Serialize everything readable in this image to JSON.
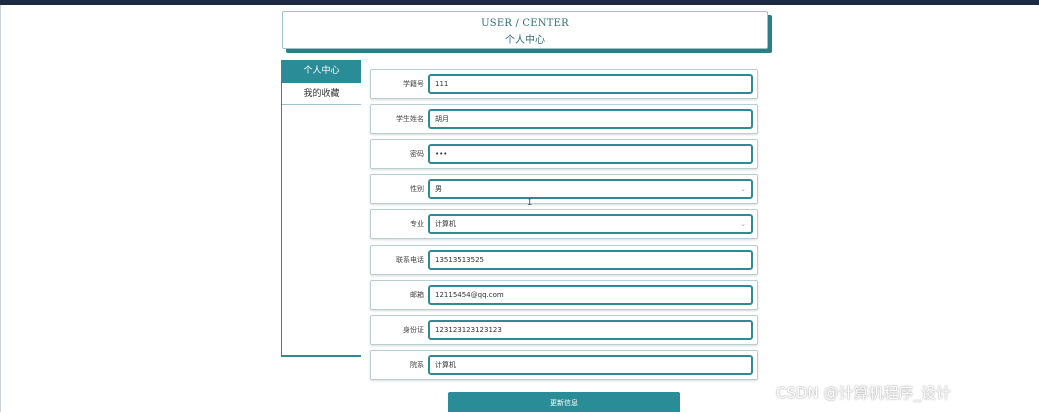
{
  "header": {
    "title_en": "USER / CENTER",
    "title_cn": "个人中心"
  },
  "sidebar": {
    "items": [
      {
        "label": "个人中心",
        "active": true
      },
      {
        "label": "我的收藏",
        "active": false
      }
    ]
  },
  "form": {
    "fields": [
      {
        "label": "学籍号",
        "value": "111",
        "type": "text"
      },
      {
        "label": "学生姓名",
        "value": "胡月",
        "type": "text"
      },
      {
        "label": "密码",
        "value": "•••",
        "type": "password"
      },
      {
        "label": "性别",
        "value": "男",
        "type": "select"
      },
      {
        "label": "专业",
        "value": "计算机",
        "type": "select"
      },
      {
        "label": "联系电话",
        "value": "13513513525",
        "type": "text"
      },
      {
        "label": "邮箱",
        "value": "12115454@qq.com",
        "type": "text"
      },
      {
        "label": "身份证",
        "value": "123123123123123",
        "type": "text"
      },
      {
        "label": "院系",
        "value": "计算机",
        "type": "text"
      }
    ],
    "submit_label": "更新信息"
  },
  "cursor_glyph": "I",
  "watermark": "CSDN @计算机程序_设计",
  "colors": {
    "accent": "#2a8c96",
    "topbar": "#1e2a44"
  }
}
